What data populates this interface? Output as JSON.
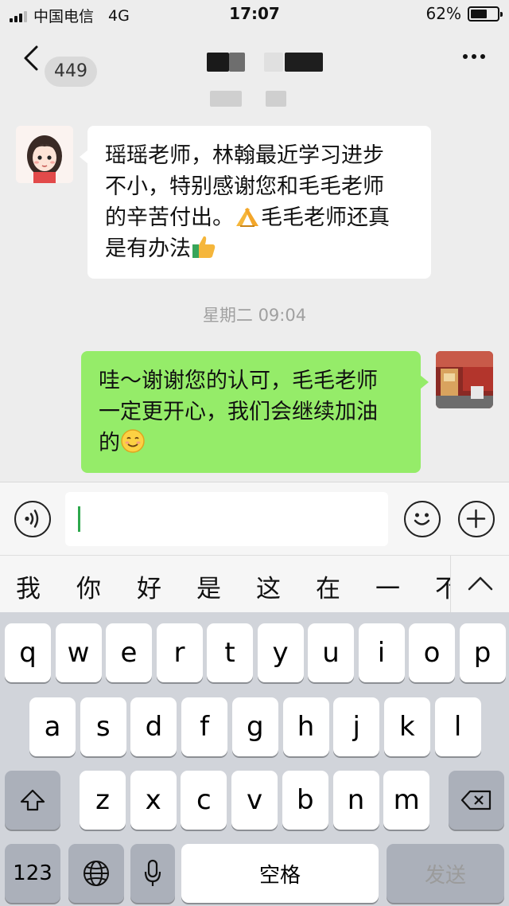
{
  "status_bar": {
    "carrier": "中国电信",
    "network": "4G",
    "time": "17:07",
    "battery_text": "62%",
    "battery_level": 0.62
  },
  "nav": {
    "unread_count": "449"
  },
  "messages": [
    {
      "direction": "incoming",
      "lines": [
        "瑶瑶老师，林翰最近学习进步",
        "不小，特别感谢您和毛毛老师",
        "的辛苦付出。",
        "毛毛老师还真",
        "是有办法"
      ],
      "emojis": [
        "folded-hands-emoji",
        "thumbs-up-emoji"
      ]
    },
    {
      "direction": "outgoing",
      "lines": [
        "哇～谢谢您的认可，毛毛老师",
        "一定更开心，我们会继续加油",
        "的"
      ],
      "emojis": [
        "smiling-face-emoji"
      ]
    }
  ],
  "timestamp": "星期二 09:04",
  "candidates": [
    "我",
    "你",
    "好",
    "是",
    "这",
    "在",
    "一",
    "不"
  ],
  "keyboard": {
    "row1": [
      "q",
      "w",
      "e",
      "r",
      "t",
      "y",
      "u",
      "i",
      "o",
      "p"
    ],
    "row2": [
      "a",
      "s",
      "d",
      "f",
      "g",
      "h",
      "j",
      "k",
      "l"
    ],
    "row3": [
      "z",
      "x",
      "c",
      "v",
      "b",
      "n",
      "m"
    ],
    "numbers_label": "123",
    "space_label": "空格",
    "send_label": "发送"
  },
  "colors": {
    "chat_background": "#ededed",
    "outgoing_bubble": "#95ec69",
    "incoming_bubble": "#ffffff",
    "keyboard_background": "#d1d4da"
  }
}
